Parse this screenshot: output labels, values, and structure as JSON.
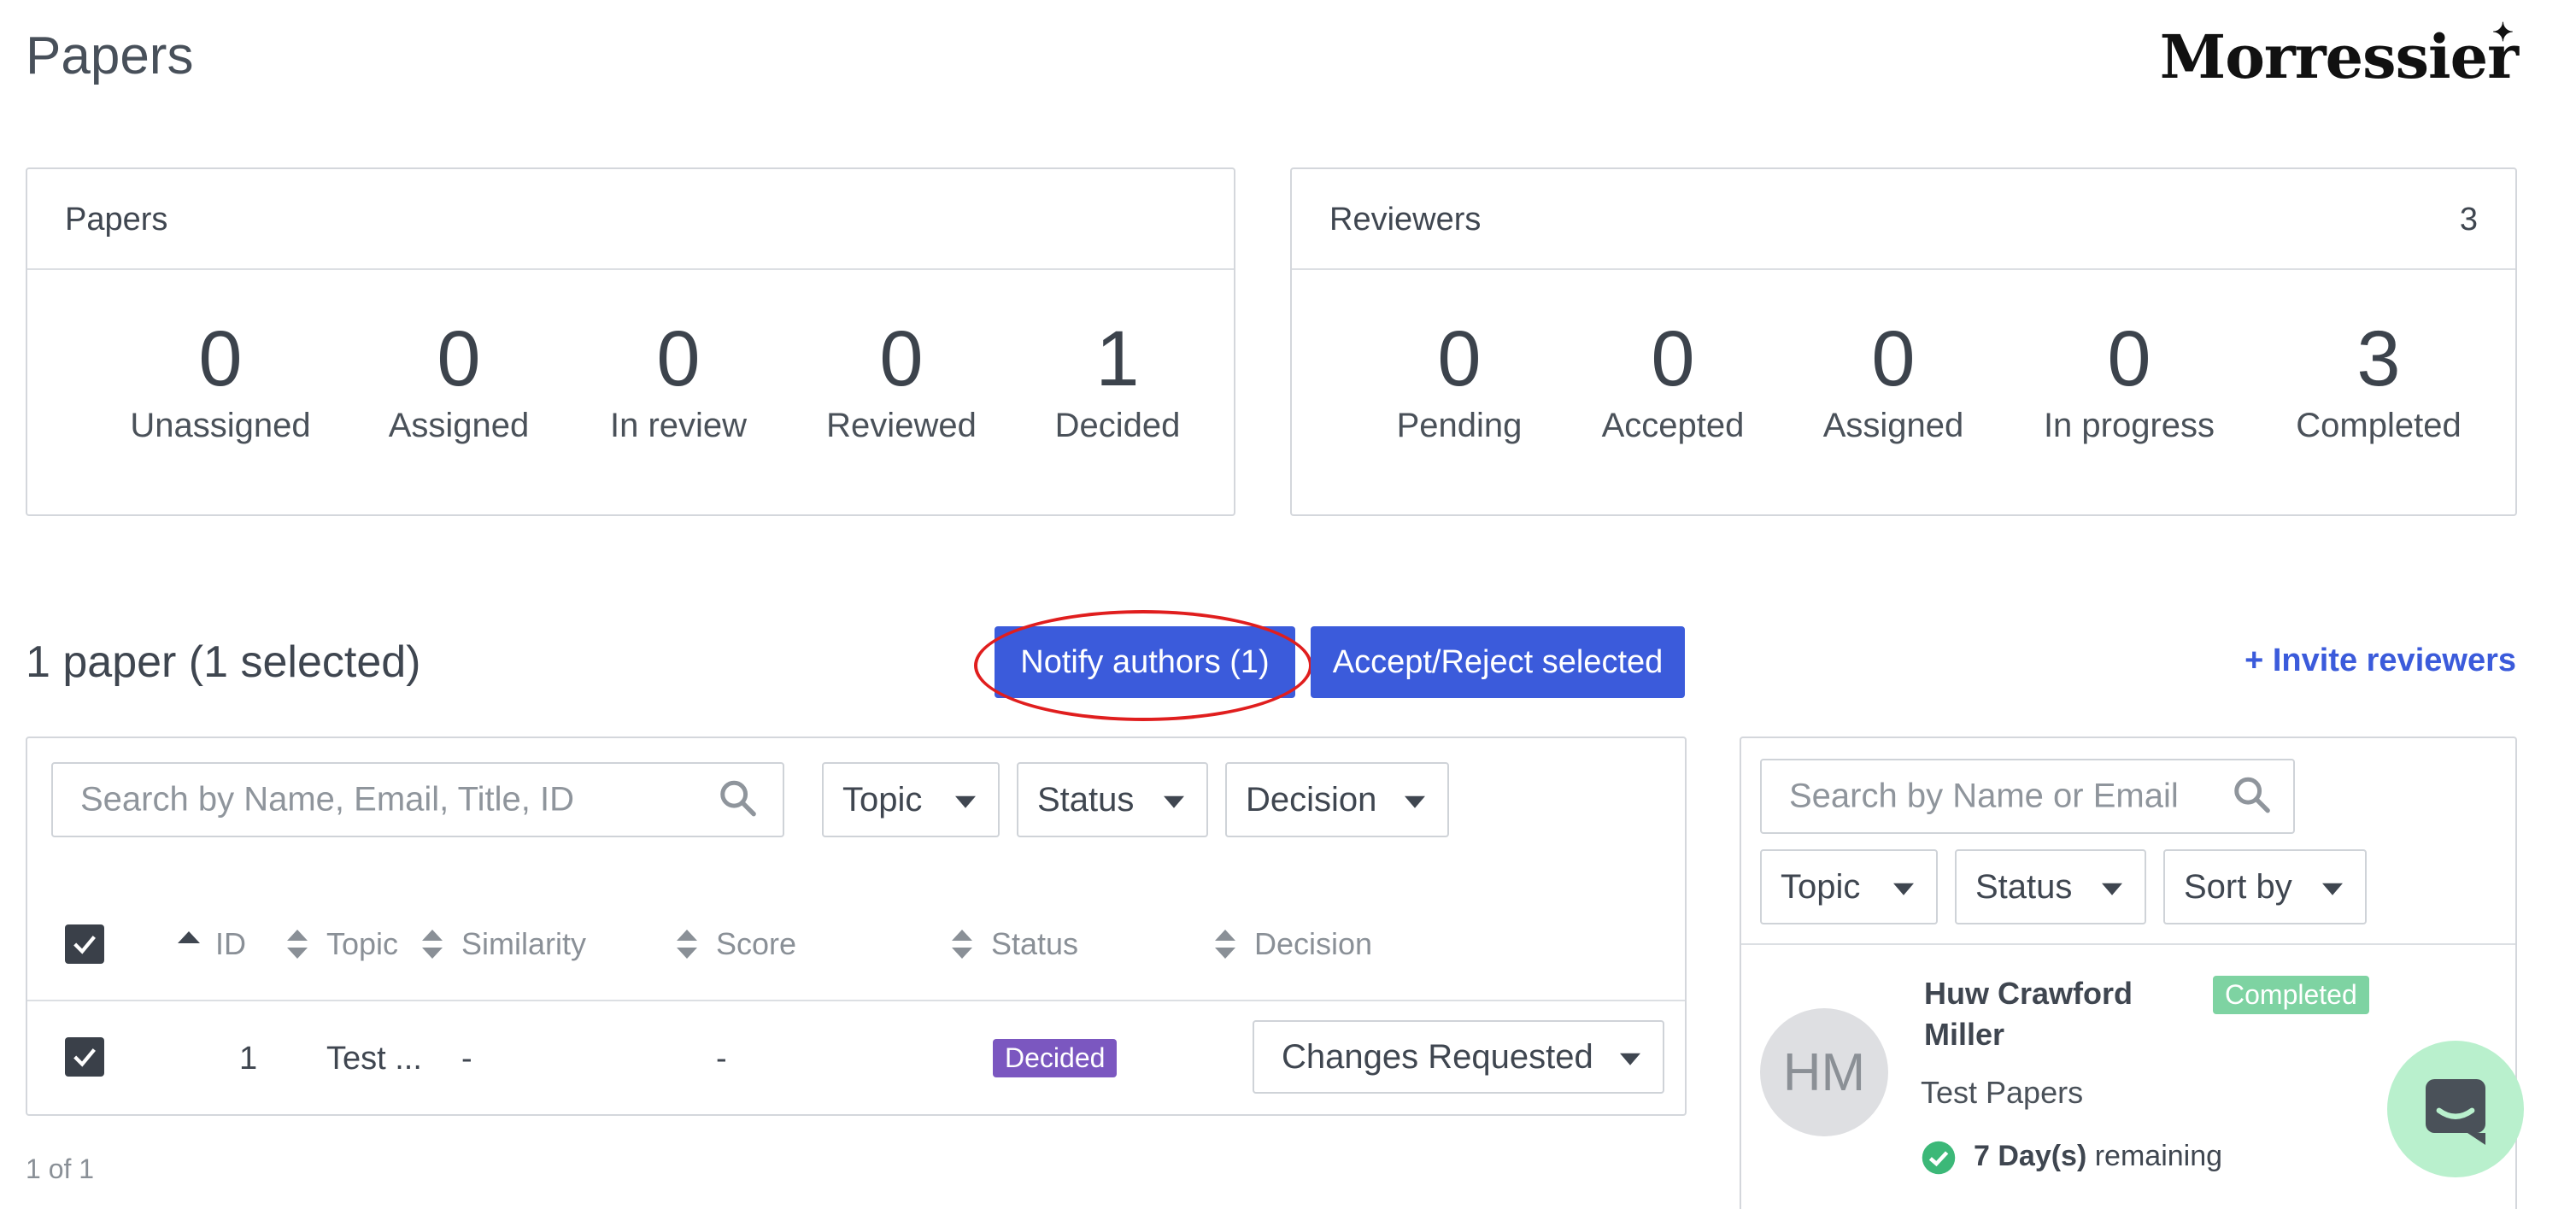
{
  "header": {
    "page_title": "Papers",
    "logo_text": "Morressier"
  },
  "papers_card": {
    "title": "Papers",
    "stats": [
      {
        "value": "0",
        "label": "Unassigned"
      },
      {
        "value": "0",
        "label": "Assigned"
      },
      {
        "value": "0",
        "label": "In review"
      },
      {
        "value": "0",
        "label": "Reviewed"
      },
      {
        "value": "1",
        "label": "Decided"
      }
    ]
  },
  "reviewers_card": {
    "title": "Reviewers",
    "count": "3",
    "stats": [
      {
        "value": "0",
        "label": "Pending"
      },
      {
        "value": "0",
        "label": "Accepted"
      },
      {
        "value": "0",
        "label": "Assigned"
      },
      {
        "value": "0",
        "label": "In progress"
      },
      {
        "value": "3",
        "label": "Completed"
      }
    ]
  },
  "toolbar": {
    "heading": "1 paper (1 selected)",
    "notify_label": "Notify authors (1)",
    "accept_reject_label": "Accept/Reject selected",
    "invite_label": "+ Invite reviewers"
  },
  "papers_table": {
    "search_placeholder": "Search by Name, Email, Title, ID",
    "filters": [
      "Topic",
      "Status",
      "Decision"
    ],
    "columns": [
      "ID",
      "Topic",
      "Similarity",
      "Score",
      "Status",
      "Decision"
    ],
    "rows": [
      {
        "id": "1",
        "topic": "Test ...",
        "similarity": "-",
        "score": "-",
        "status": "Decided",
        "decision": "Changes Requested"
      }
    ],
    "pagination": "1 of 1"
  },
  "reviewers_panel": {
    "search_placeholder": "Search by Name or Email",
    "filters": [
      "Topic",
      "Status",
      "Sort by"
    ],
    "reviewer": {
      "initials": "HM",
      "name_line1": "Huw Crawford",
      "name_line2": "Miller",
      "status": "Completed",
      "group": "Test Papers",
      "remaining_days": "7 Day(s)",
      "remaining_suffix": "remaining"
    }
  },
  "colors": {
    "primary": "#3b5bdb",
    "decided": "#7b57c0",
    "completed": "#7ed3a2",
    "highlight": "#e01e1e"
  }
}
